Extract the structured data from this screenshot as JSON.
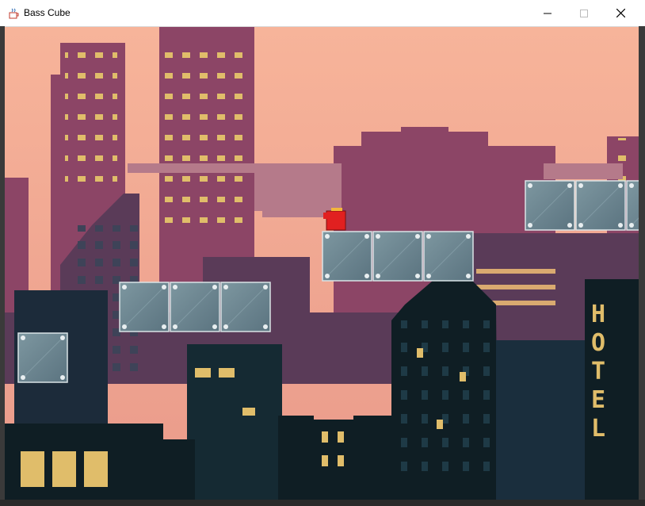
{
  "window": {
    "title": "Bass Cube",
    "icon": "java-cup-icon",
    "controls": [
      "minimize-icon",
      "maximize-icon",
      "close-icon"
    ]
  },
  "game": {
    "scene": "pixel-city-sunset",
    "colors": {
      "sky": "#f6b59b",
      "far_buildings": "#8c4566",
      "mid_buildings": "#4e3350",
      "near_buildings": "#0f1e24",
      "windows": "#e0bd6a",
      "platform": "#708c96",
      "player": "#e12020"
    },
    "player": {
      "type": "red-cube-player"
    },
    "sign": {
      "letters": [
        "H",
        "O",
        "T",
        "E",
        "L"
      ]
    }
  }
}
